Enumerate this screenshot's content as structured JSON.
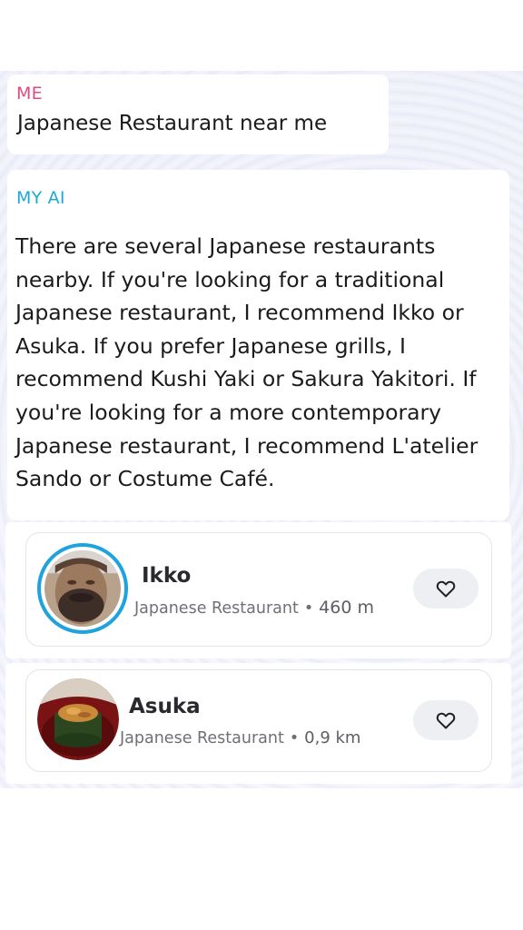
{
  "chat": {
    "me": {
      "sender": "ME",
      "message": "Japanese Restaurant near me"
    },
    "ai": {
      "sender": "MY AI",
      "message": "There are several Japanese restaurants nearby. If you're looking for a traditional Japanese restaurant, I recommend Ikko or Asuka. If you prefer Japanese grills, I recommend Kushi Yaki or Sakura Yakitori. If you're looking for a more contemporary Japanese restaurant, I recommend L'atelier Sando or Costume Café."
    }
  },
  "places": [
    {
      "name": "Ikko",
      "category": "Japanese Restaurant",
      "separator": "•",
      "distance": "460  m",
      "avatar_icon": "person-photo",
      "favorite_icon": "heart-outline-icon"
    },
    {
      "name": "Asuka",
      "category": "Japanese Restaurant",
      "separator": "•",
      "distance": "0,9 km",
      "avatar_icon": "food-photo",
      "favorite_icon": "heart-outline-icon"
    }
  ],
  "colors": {
    "me_label": "#e14b7c",
    "ai_label": "#1ba9d6",
    "story_ring": "#1fa3dd",
    "fav_button_bg": "#eeeff2"
  }
}
